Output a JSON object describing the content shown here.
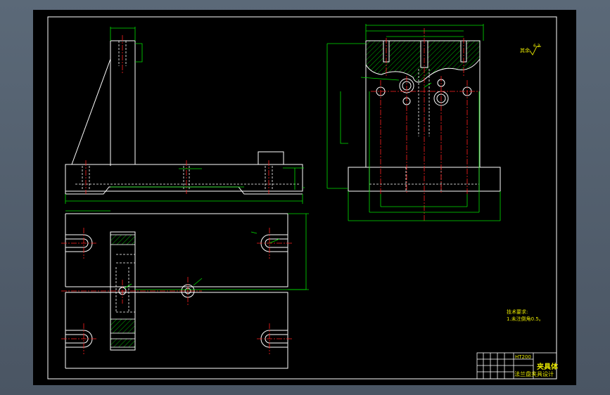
{
  "drawing": {
    "roughness_label": "其余",
    "roughness_value": "6.3",
    "notes_title": "技术要求:",
    "notes_line1": "1.未注倒角0.5。",
    "material": "HT200",
    "title_name": "夹具体",
    "title_sub": "法兰盘夹具设计"
  },
  "colors": {
    "sheet_bg": "#000000",
    "outline": "#ffffff",
    "dimension": "#00ff00",
    "centerline": "#ff0000",
    "hatch": "#00ff00",
    "text": "#e8e800"
  }
}
